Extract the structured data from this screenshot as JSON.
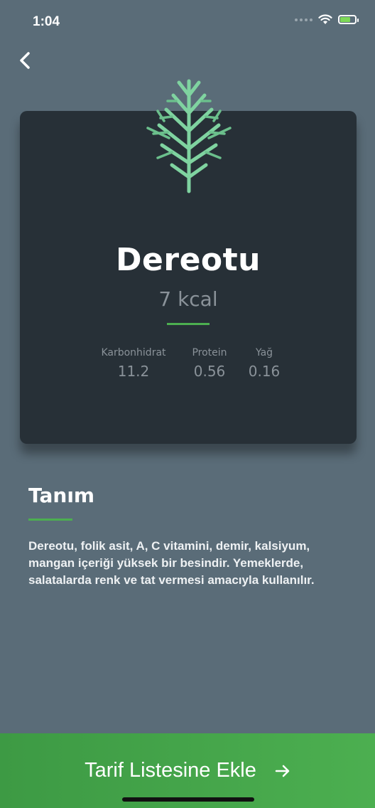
{
  "status_bar": {
    "time": "1:04"
  },
  "food": {
    "name": "Dereotu",
    "kcal": "7 kcal",
    "icon": "dill-plant-icon"
  },
  "macros": [
    {
      "label": "Karbonhidrat",
      "value": "11.2"
    },
    {
      "label": "Protein",
      "value": "0.56"
    },
    {
      "label": "Yağ",
      "value": "0.16"
    }
  ],
  "description": {
    "title": "Tanım",
    "text": "Dereotu, folik asit, A, C vitamini, demir, kalsiyum, mangan içeriği yüksek bir besindir. Yemeklerde, salatalarda renk ve tat vermesi amacıyla kullanılır."
  },
  "cta": {
    "label": "Tarif Listesine Ekle",
    "icon": "arrow-right-icon"
  },
  "colors": {
    "background": "#5a6c78",
    "card": "#273037",
    "accent": "#4caf50",
    "plant": "#7fd3a0",
    "muted_text": "#8a9299"
  }
}
